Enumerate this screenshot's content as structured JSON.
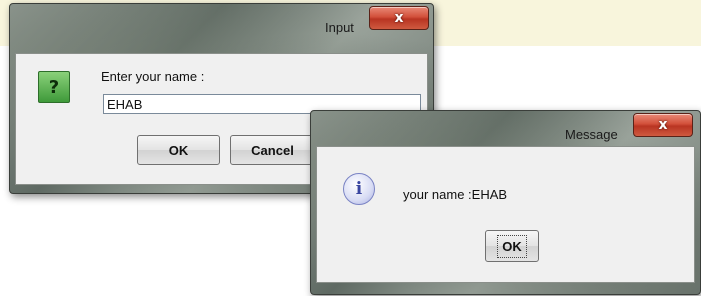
{
  "input_dialog": {
    "title": "Input",
    "close_glyph": "x",
    "icon": "question-icon",
    "icon_glyph": "?",
    "prompt": "Enter your name :",
    "input_value": "EHAB",
    "ok_label": "OK",
    "cancel_label": "Cancel"
  },
  "message_dialog": {
    "title": "Message",
    "close_glyph": "x",
    "icon": "info-icon",
    "icon_glyph": "i",
    "message": "your name :EHAB",
    "ok_label": "OK"
  },
  "colors": {
    "background_band": "#f8f5dc",
    "close_button": "#c9432c",
    "question_icon": "#5cb34c",
    "info_icon": "#a8afe0"
  }
}
